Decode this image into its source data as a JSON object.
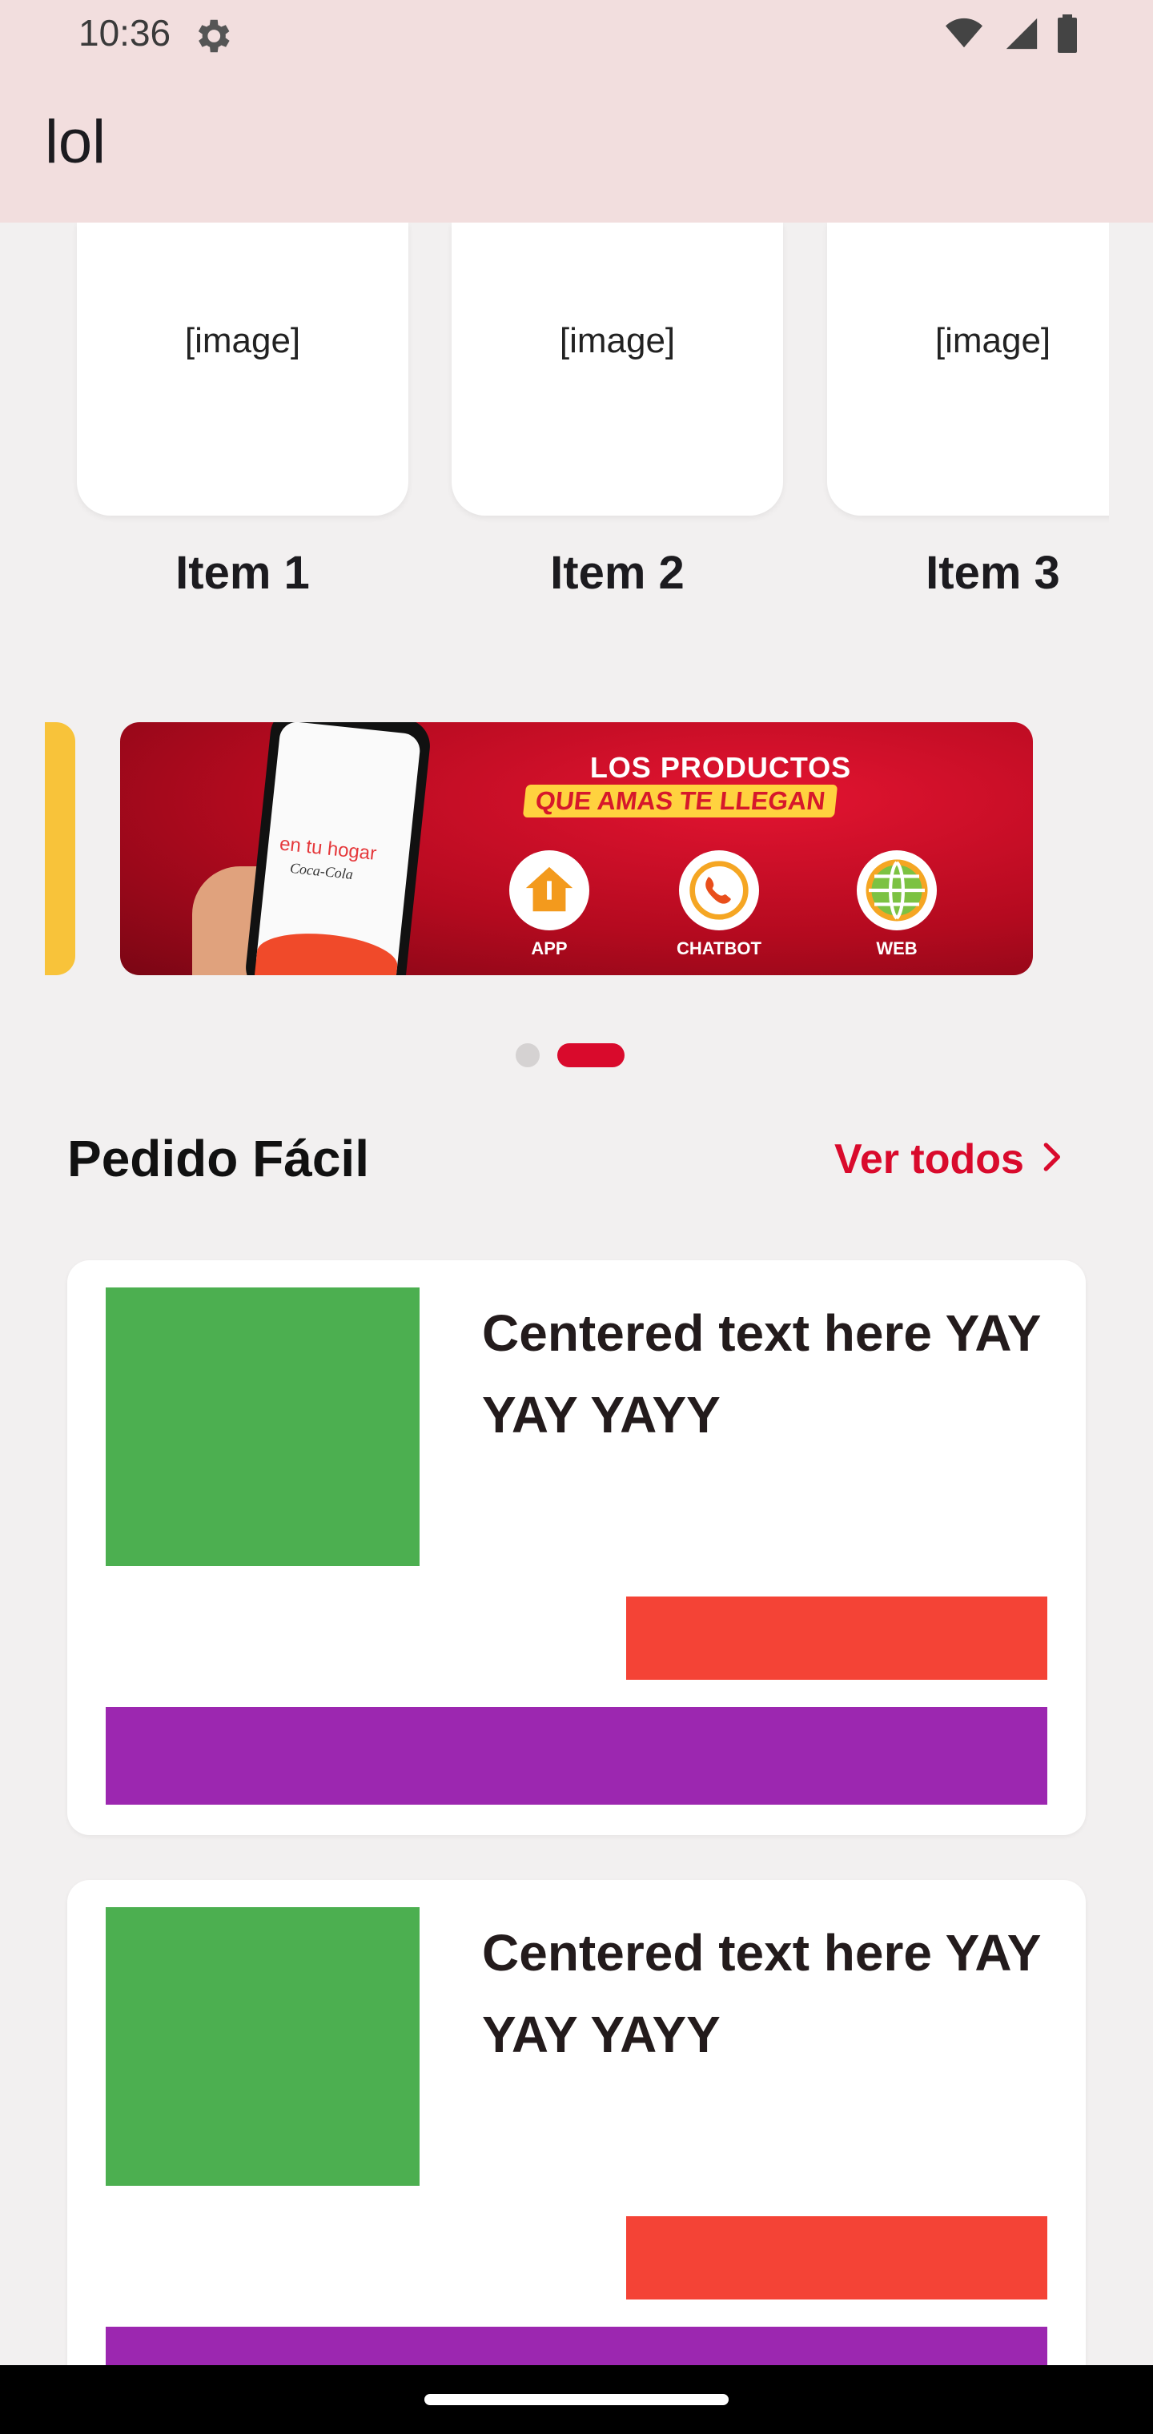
{
  "status_bar": {
    "time": "10:36"
  },
  "app_bar": {
    "title": "lol"
  },
  "items": [
    {
      "image_alt": "[image]",
      "label": "Item 1"
    },
    {
      "image_alt": "[image]",
      "label": "Item 2"
    },
    {
      "image_alt": "[image]",
      "label": "Item 3"
    }
  ],
  "banner": {
    "title": "LOS PRODUCTOS",
    "subtitle": "QUE AMAS TE LLEGAN",
    "phone_brand": "en tu hogar",
    "phone_by": "Coca-Cola",
    "channels": [
      {
        "icon": "app-house-icon",
        "label": "APP"
      },
      {
        "icon": "whatsapp-icon",
        "label": "CHATBOT"
      },
      {
        "icon": "globe-icon",
        "label": "WEB"
      }
    ],
    "active_index": 1,
    "total": 2
  },
  "section": {
    "title": "Pedido Fácil",
    "see_all": "Ver todos"
  },
  "cards": [
    {
      "text": "Centered text here YAY YAY YAYY"
    },
    {
      "text": "Centered text here YAY YAY YAYY"
    }
  ],
  "colors": {
    "accent": "#d90a2c",
    "appbar": "#f2dede",
    "green": "#4caf50",
    "red": "#f44336",
    "purple": "#9c27b0"
  }
}
